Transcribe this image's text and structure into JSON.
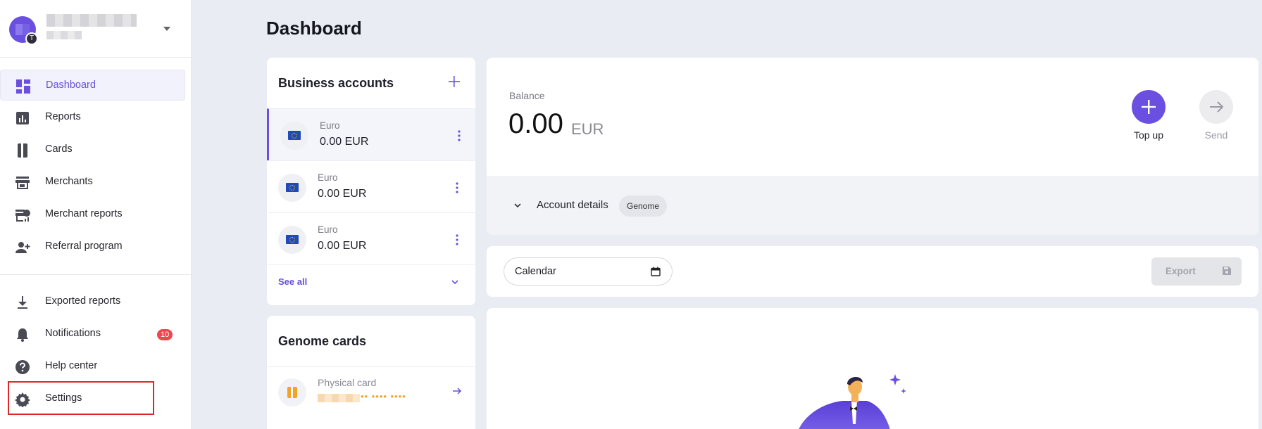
{
  "sidebar": {
    "avatar_badge": "T",
    "nav": [
      {
        "label": "Dashboard",
        "icon": "dashboard-icon"
      },
      {
        "label": "Reports",
        "icon": "reports-icon"
      },
      {
        "label": "Cards",
        "icon": "cards-icon"
      },
      {
        "label": "Merchants",
        "icon": "store-icon"
      },
      {
        "label": "Merchant reports",
        "icon": "merchant-reports-icon"
      },
      {
        "label": "Referral program",
        "icon": "add-user-icon"
      }
    ],
    "bottom_nav": [
      {
        "label": "Exported reports",
        "icon": "download-icon"
      },
      {
        "label": "Notifications",
        "icon": "bell-icon",
        "badge": "10"
      },
      {
        "label": "Help center",
        "icon": "help-icon"
      },
      {
        "label": "Settings",
        "icon": "gear-icon"
      }
    ],
    "active": "Dashboard",
    "highlighted": "Settings"
  },
  "main": {
    "title": "Dashboard",
    "business_accounts": {
      "title": "Business accounts",
      "accounts": [
        {
          "name": "Euro",
          "amount": "0.00 EUR"
        },
        {
          "name": "Euro",
          "amount": "0.00 EUR"
        },
        {
          "name": "Euro",
          "amount": "0.00 EUR"
        }
      ],
      "see_all": "See all"
    },
    "genome_cards": {
      "title": "Genome cards",
      "card_name": "Physical card",
      "card_digits": "•• •••• ••••"
    },
    "balance": {
      "label": "Balance",
      "amount": "0.00",
      "currency": "EUR",
      "topup_label": "Top up",
      "send_label": "Send",
      "details_label": "Account details",
      "details_chip": "Genome"
    },
    "filters": {
      "calendar_placeholder": "Calendar",
      "export_label": "Export"
    }
  },
  "colors": {
    "accent": "#6a4fe0",
    "badge": "#f0464e",
    "highlight": "#e0262c"
  }
}
